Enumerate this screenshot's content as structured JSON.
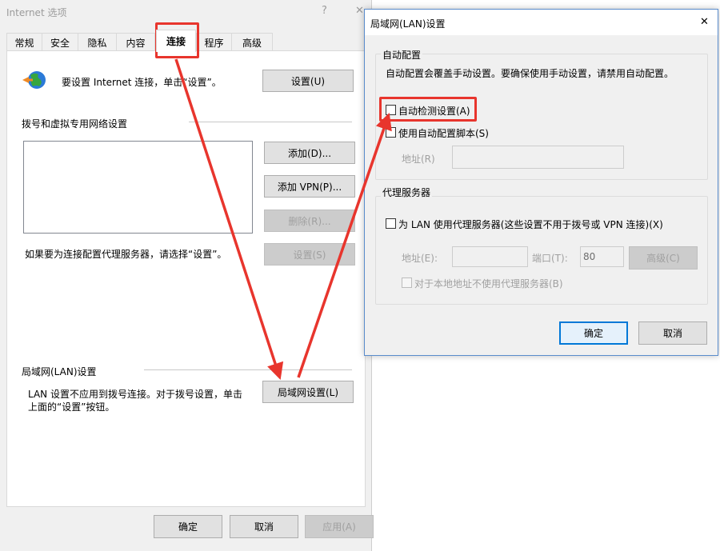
{
  "main_dialog": {
    "title": "Internet 选项",
    "help_glyph": "?",
    "close_glyph": "✕",
    "tabs": [
      {
        "label": "常规"
      },
      {
        "label": "安全"
      },
      {
        "label": "隐私"
      },
      {
        "label": "内容"
      },
      {
        "label": "连接"
      },
      {
        "label": "程序"
      },
      {
        "label": "高级"
      }
    ],
    "setup_text": "要设置 Internet 连接，单击“设置”。",
    "setup_button": "设置(U)",
    "dialup_header": "拨号和虚拟专用网络设置",
    "add_button": "添加(D)...",
    "add_vpn_button": "添加 VPN(P)...",
    "delete_button": "删除(R)...",
    "proxy_hint": "如果要为连接配置代理服务器，请选择“设置”。",
    "settings_button": "设置(S)",
    "lan_header": "局域网(LAN)设置",
    "lan_desc_line1": "LAN 设置不应用到拨号连接。对于拨号设置，单击",
    "lan_desc_line2": "上面的“设置”按钮。",
    "lan_settings_button": "局域网设置(L)",
    "ok_button": "确定",
    "cancel_button": "取消",
    "apply_button": "应用(A)"
  },
  "lan_dialog": {
    "title": "局域网(LAN)设置",
    "close_glyph": "✕",
    "auto_config_header": "自动配置",
    "auto_config_desc": "自动配置会覆盖手动设置。要确保使用手动设置，请禁用自动配置。",
    "auto_detect_label": "自动检测设置(A)",
    "auto_script_label": "使用自动配置脚本(S)",
    "address_label": "地址(R)",
    "address_value": "",
    "proxy_header": "代理服务器",
    "use_proxy_label": "为 LAN 使用代理服务器(这些设置不用于拨号或 VPN 连接)(X)",
    "proxy_address_label": "地址(E):",
    "proxy_address_value": "",
    "port_label": "端口(T):",
    "port_value": "80",
    "advanced_button": "高级(C)",
    "bypass_local_label": "对于本地地址不使用代理服务器(B)",
    "ok_button": "确定",
    "cancel_button": "取消"
  },
  "colors": {
    "annotation_red": "#e8352d",
    "accent_blue": "#0078d7"
  }
}
